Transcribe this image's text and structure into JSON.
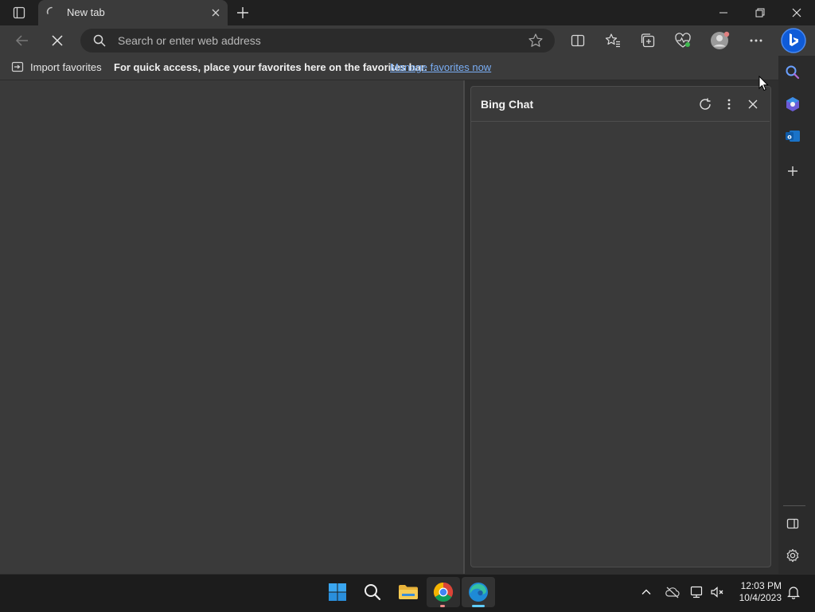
{
  "browser": {
    "tab": {
      "title": "New tab"
    },
    "address_bar": {
      "placeholder": "Search or enter web address",
      "value": ""
    }
  },
  "favorites_bar": {
    "import_label": "Import favorites",
    "message": "For quick access, place your favorites here on the favorites bar.",
    "manage_link": "Manage favorites now"
  },
  "bing_chat": {
    "title": "Bing Chat"
  },
  "taskbar": {
    "time": "12:03 PM",
    "date": "10/4/2023"
  },
  "colors": {
    "accent_link": "#7aaef5",
    "edge_indicator": "#60cdff",
    "bing_brand": "#1a73e8"
  },
  "icons": {
    "tab_actions": "tab-actions-icon",
    "tab_spinner": "loading-spinner-icon",
    "stop": "stop-loading-icon",
    "split_screen": "split-screen-icon",
    "favorites": "favorites-icon",
    "collections": "collections-icon",
    "performance": "browser-essentials-icon",
    "profile": "profile-icon",
    "more": "more-icon",
    "bing": "bing-chat-icon",
    "sidebar_search": "search-icon",
    "sidebar_copilot": "copilot-icon",
    "sidebar_outlook": "outlook-icon"
  }
}
